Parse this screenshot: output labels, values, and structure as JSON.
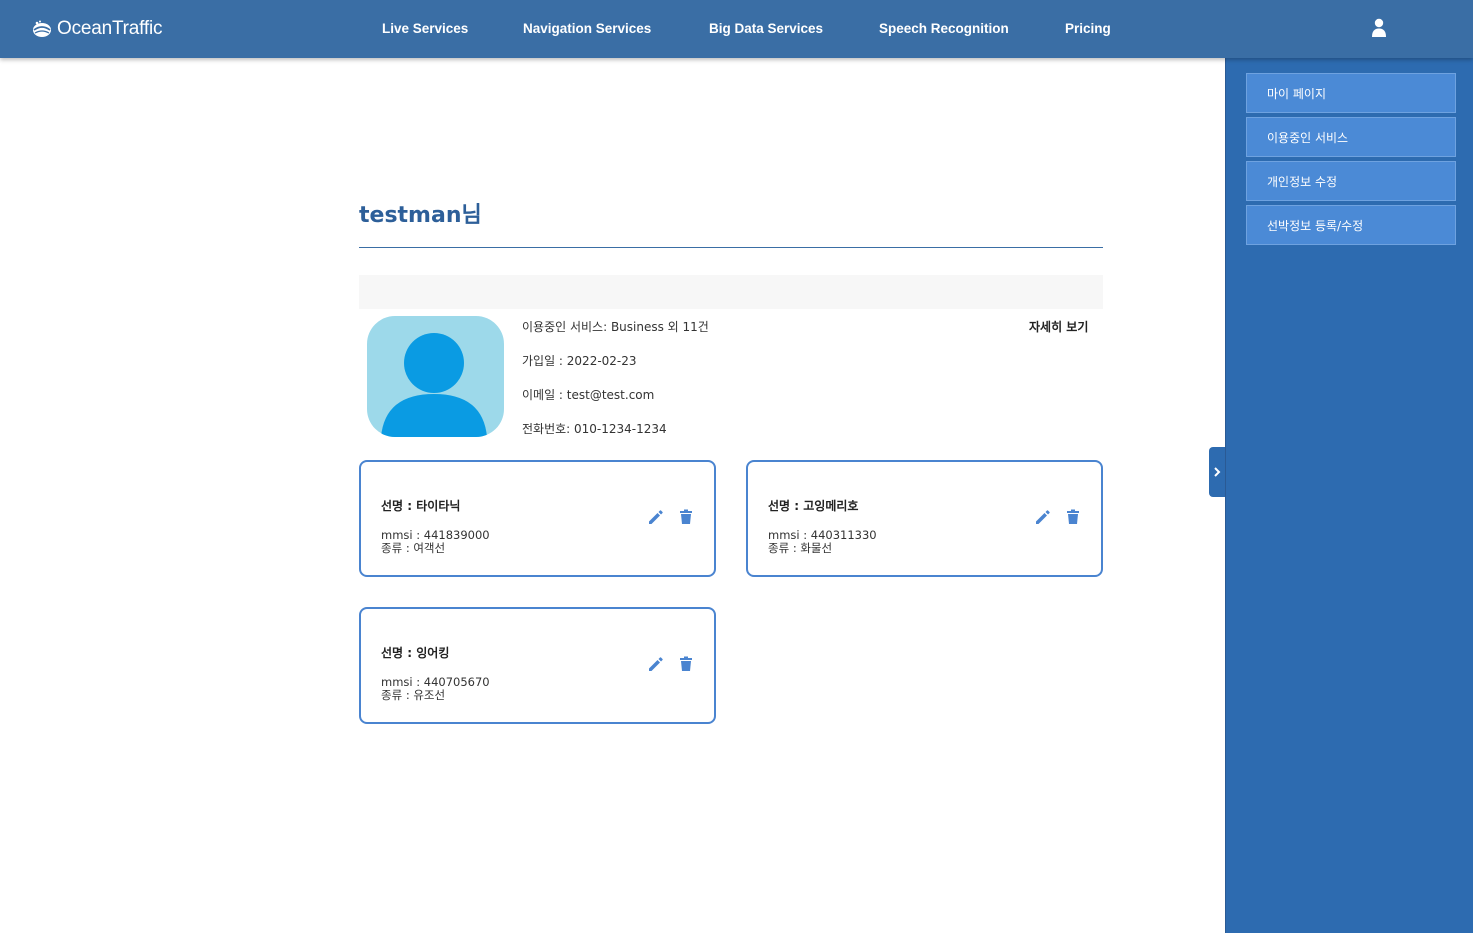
{
  "header": {
    "logo_text": "OceanTraffic",
    "nav": [
      {
        "label": "Live Services"
      },
      {
        "label": "Navigation Services"
      },
      {
        "label": "Big Data Services"
      },
      {
        "label": "Speech Recognition"
      },
      {
        "label": "Pricing"
      }
    ],
    "user_icon": "user-icon"
  },
  "sidebar": {
    "items": [
      {
        "label": "마이 페이지"
      },
      {
        "label": "이용중인 서비스"
      },
      {
        "label": "개인정보 수정"
      },
      {
        "label": "선박정보 등록/수정"
      }
    ],
    "toggle_icon": "chevron-right-icon"
  },
  "profile": {
    "title": "testman님",
    "service": "이용중인 서비스: Business 외 11건",
    "joined": "가입일 : 2022-02-23",
    "email": "이메일 : test@test.com",
    "phone": "전화번호: 010-1234-1234",
    "detail_link": "자세히 보기"
  },
  "ships": [
    {
      "name": "선명 : 타이타닉",
      "mmsi": "mmsi : 441839000",
      "type": "종류 : 여객선"
    },
    {
      "name": "선명 : 고잉메리호",
      "mmsi": "mmsi : 440311330",
      "type": "종류 : 화물선"
    },
    {
      "name": "선명 : 잉어킹",
      "mmsi": "mmsi : 440705670",
      "type": "종류 : 유조선"
    }
  ],
  "colors": {
    "header_bg": "#3a6ea5",
    "sidebar_bg": "#2d6bb0",
    "sidebar_button": "#4b8ad6",
    "accent": "#4a84d0",
    "title": "#2d5f99",
    "avatar_bg": "#9dd9ea",
    "avatar_figure": "#0a9be3"
  }
}
